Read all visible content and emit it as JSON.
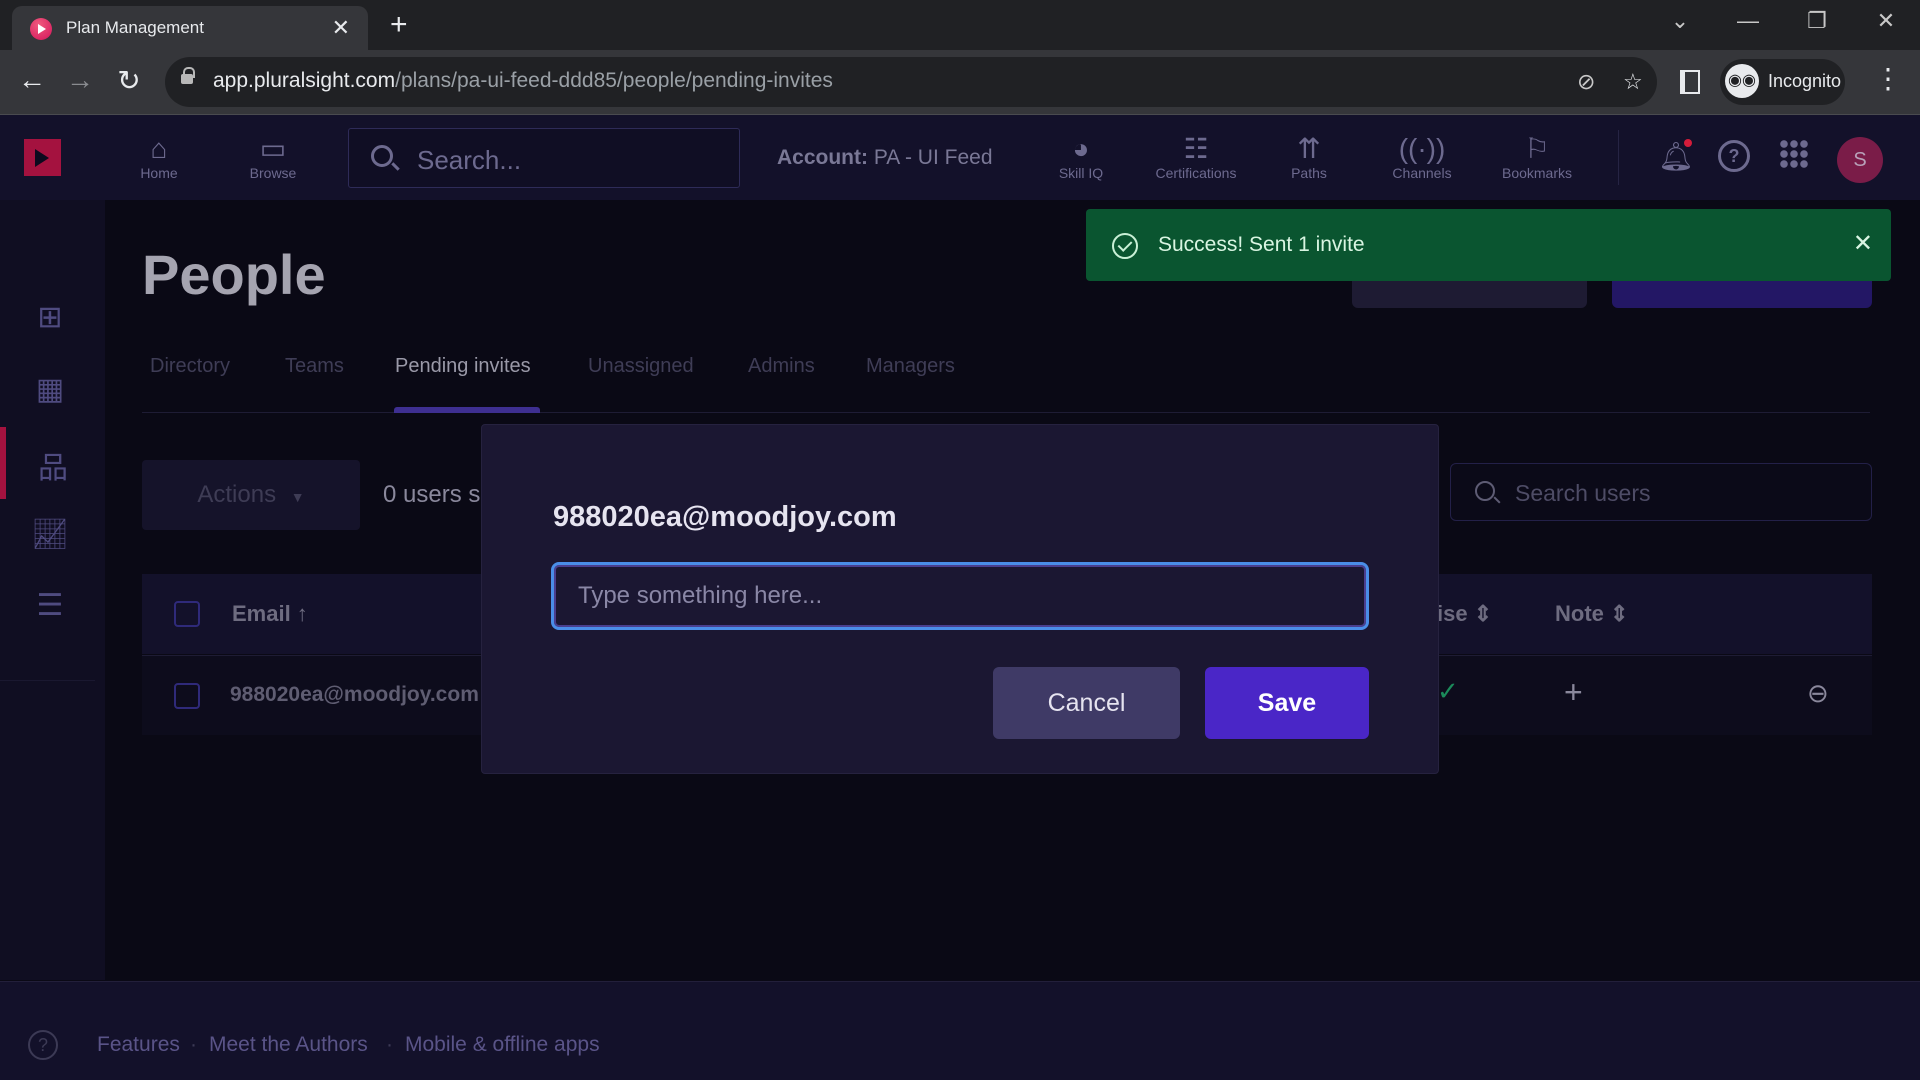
{
  "browser": {
    "tab_title": "Plan Management",
    "url_host": "app.pluralsight.com",
    "url_path": "/plans/pa-ui-feed-ddd85/people/pending-invites",
    "profile_label": "Incognito"
  },
  "topnav": {
    "search_placeholder": "Search...",
    "account_label": "Account:",
    "account_name": "PA - UI Feed",
    "items": [
      {
        "label": "Home",
        "icon": "home-icon"
      },
      {
        "label": "Browse",
        "icon": "browse-icon"
      },
      {
        "label": "Skill IQ",
        "icon": "skill-iq-icon"
      },
      {
        "label": "Certifications",
        "icon": "certifications-icon"
      },
      {
        "label": "Paths",
        "icon": "paths-icon"
      },
      {
        "label": "Channels",
        "icon": "channels-icon"
      },
      {
        "label": "Bookmarks",
        "icon": "bookmarks-icon"
      }
    ],
    "avatar_initial": "S"
  },
  "page": {
    "title": "People",
    "tabs": [
      {
        "label": "Directory"
      },
      {
        "label": "Teams"
      },
      {
        "label": "Pending invites",
        "active": true
      },
      {
        "label": "Unassigned"
      },
      {
        "label": "Admins"
      },
      {
        "label": "Managers"
      }
    ],
    "actions_label": "Actions",
    "users_selected": "0 users s",
    "search_users_placeholder": "Search users",
    "table": {
      "columns": [
        "Email ↑",
        "ise ⇕",
        "Note ⇕"
      ],
      "rows": [
        {
          "email": "988020ea@moodjoy.com"
        }
      ]
    }
  },
  "toast": {
    "message": "Success! Sent 1 invite",
    "color": "#0a5530"
  },
  "modal": {
    "email": "988020ea@moodjoy.com",
    "input_value": "",
    "input_placeholder": "Type something here...",
    "cancel_label": "Cancel",
    "save_label": "Save"
  },
  "footer": {
    "links": [
      "Features",
      "Meet the Authors",
      "Mobile & offline apps"
    ]
  }
}
